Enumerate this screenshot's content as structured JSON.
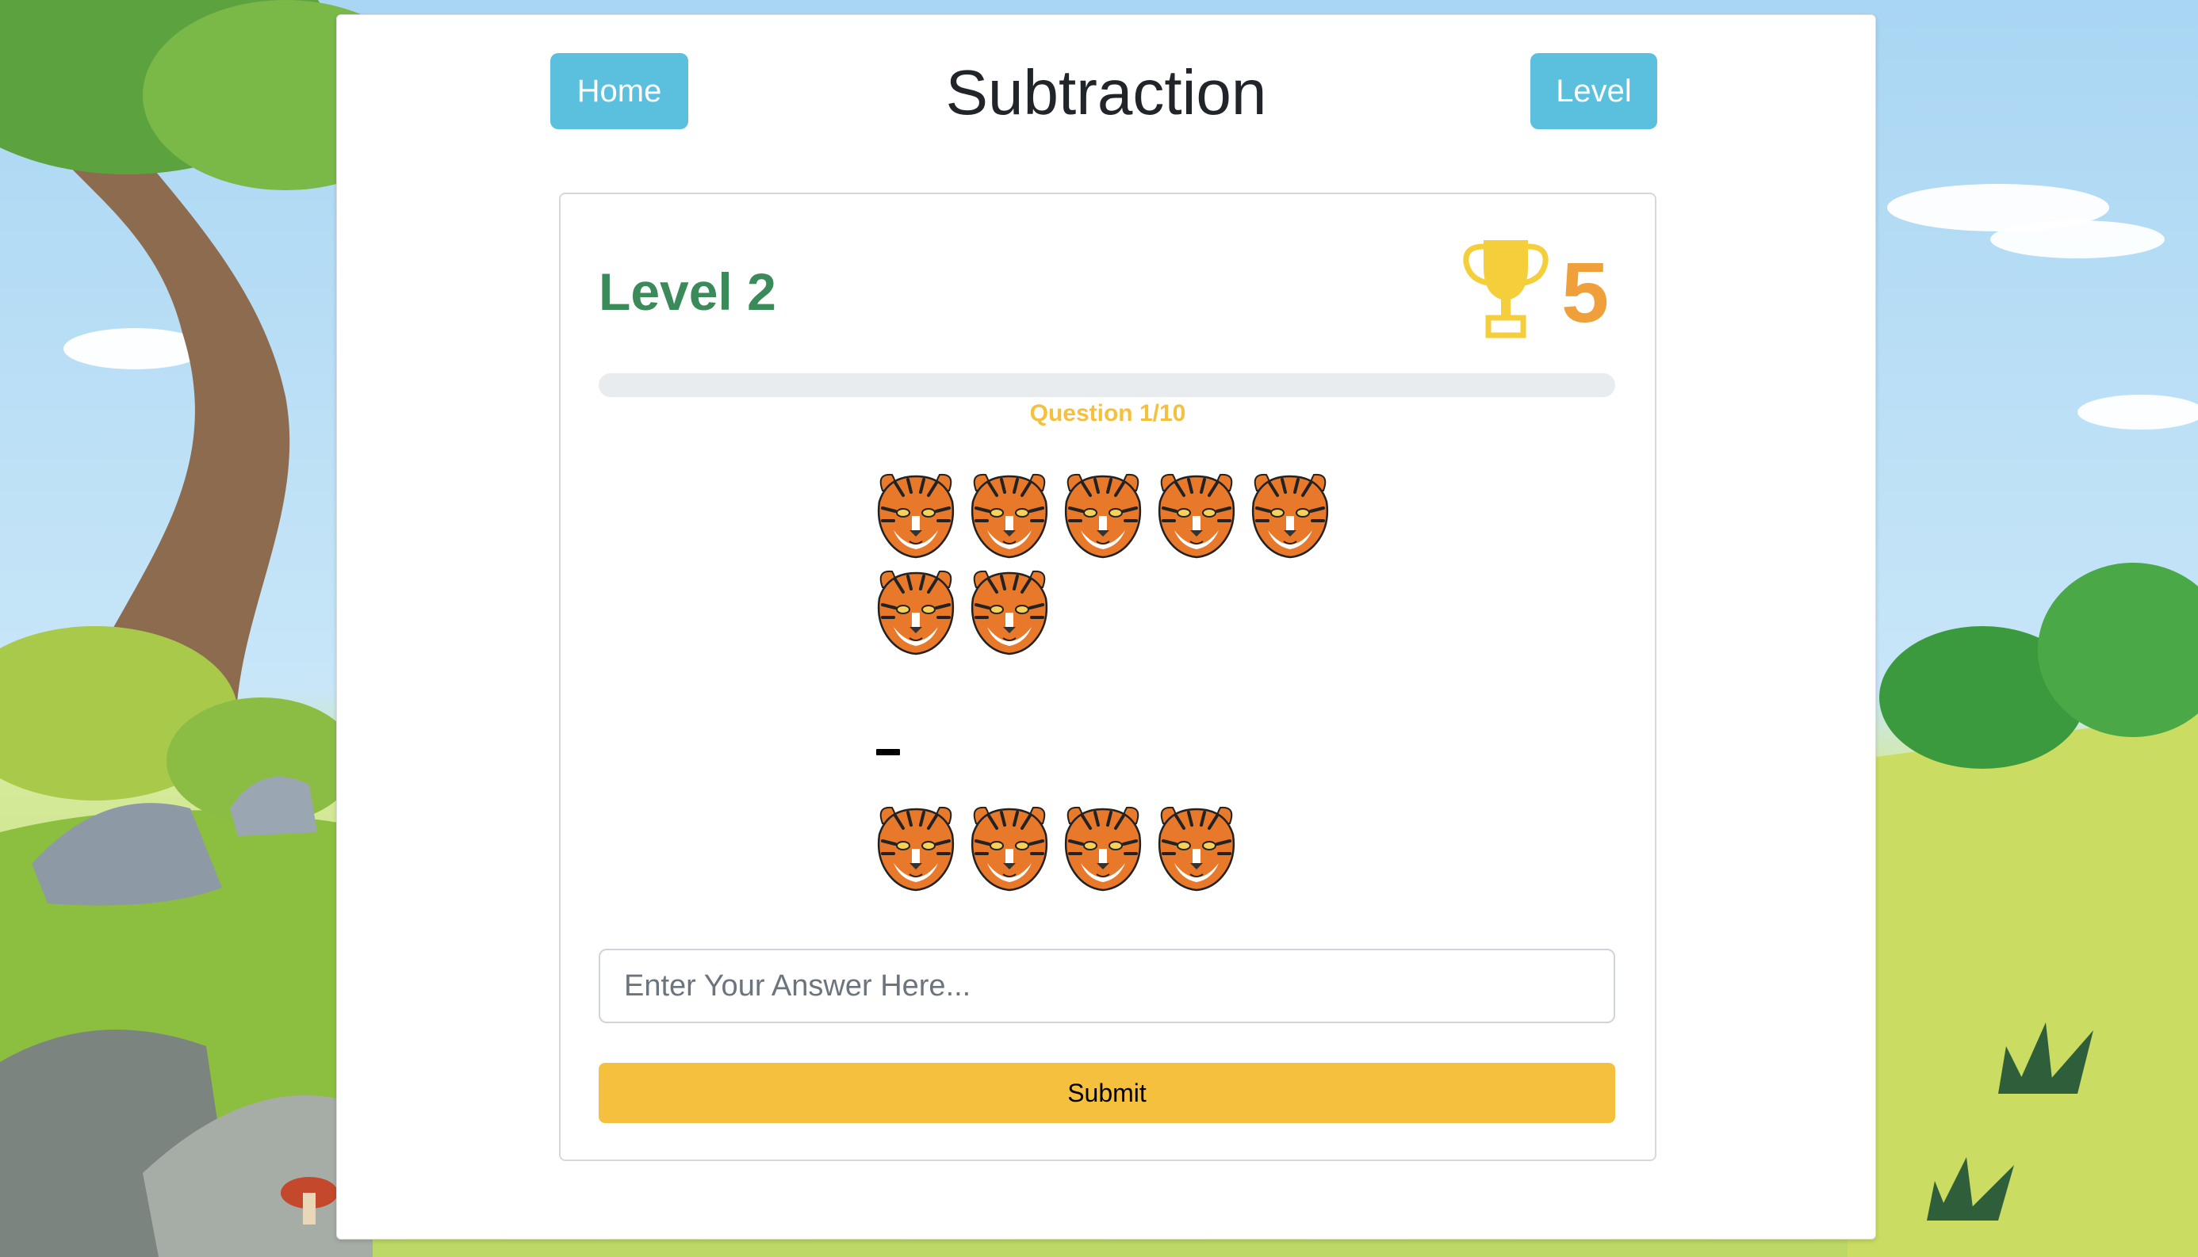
{
  "header": {
    "title": "Subtraction",
    "home_label": "Home",
    "level_label": "Level"
  },
  "game": {
    "level_text": "Level 2",
    "score": "5",
    "question_counter": "Question 1/10",
    "progress_fraction": 0.0,
    "minuend_count": 7,
    "subtrahend_count": 4,
    "operator_symbol": "−",
    "answer_placeholder": "Enter Your Answer Here...",
    "answer_value": "",
    "submit_label": "Submit"
  },
  "icons": {
    "trophy": "trophy-icon",
    "counting_item": "tiger-face-icon"
  },
  "colors": {
    "nav_button": "#5bc0de",
    "level_text": "#3b8a5a",
    "score": "#f0a03a",
    "accent_yellow": "#f6c03f",
    "trophy": "#f5cf3b"
  }
}
